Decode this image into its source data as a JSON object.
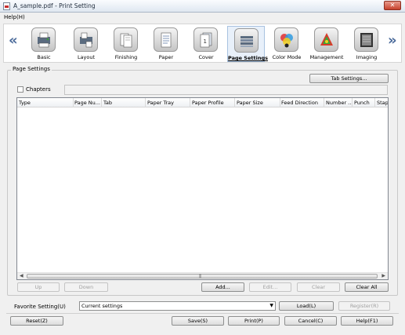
{
  "window": {
    "title": "A_sample.pdf - Print Setting",
    "close_glyph": "✕"
  },
  "menu": {
    "help": "Help(H)"
  },
  "ribbon": {
    "prev_arrow": "«",
    "next_arrow": "»",
    "tabs": [
      {
        "label": "Basic",
        "icon": "basic-icon"
      },
      {
        "label": "Layout",
        "icon": "layout-icon"
      },
      {
        "label": "Finishing",
        "icon": "finishing-icon"
      },
      {
        "label": "Paper",
        "icon": "paper-icon"
      },
      {
        "label": "Cover",
        "icon": "cover-icon"
      },
      {
        "label": "Page Settings",
        "icon": "page-settings-icon",
        "selected": true
      },
      {
        "label": "Color Mode",
        "icon": "color-mode-icon"
      },
      {
        "label": "Management",
        "icon": "management-icon"
      },
      {
        "label": "Imaging",
        "icon": "imaging-icon"
      }
    ]
  },
  "page_settings": {
    "group_label": "Page Settings",
    "tab_settings_button": "Tab Settings...",
    "chapters_label": "Chapters",
    "chapters_checked": false,
    "chapters_value": "",
    "table": {
      "columns": [
        "Type",
        "Page Nu...",
        "Tab",
        "Paper Tray",
        "Paper Profile",
        "Paper Size",
        "Feed Direction",
        "Number ...",
        "Punch",
        "Staple"
      ],
      "rows": []
    },
    "buttons": {
      "up": "Up",
      "down": "Down",
      "add": "Add...",
      "edit": "Edit...",
      "clear": "Clear",
      "clear_all": "Clear All"
    }
  },
  "favorite": {
    "label": "Favorite Setting(U)",
    "selected": "Current settings",
    "load": "Load(L)",
    "register": "Register(R)"
  },
  "footer": {
    "reset": "Reset(Z)",
    "save": "Save(S)",
    "print": "Print(P)",
    "cancel": "Cancel(C)",
    "help": "Help(F1)"
  },
  "colors": {
    "accent": "#4a6a9a",
    "selected_tab_bg": "#e8f0fa",
    "disabled_text": "#a0a0a0"
  }
}
